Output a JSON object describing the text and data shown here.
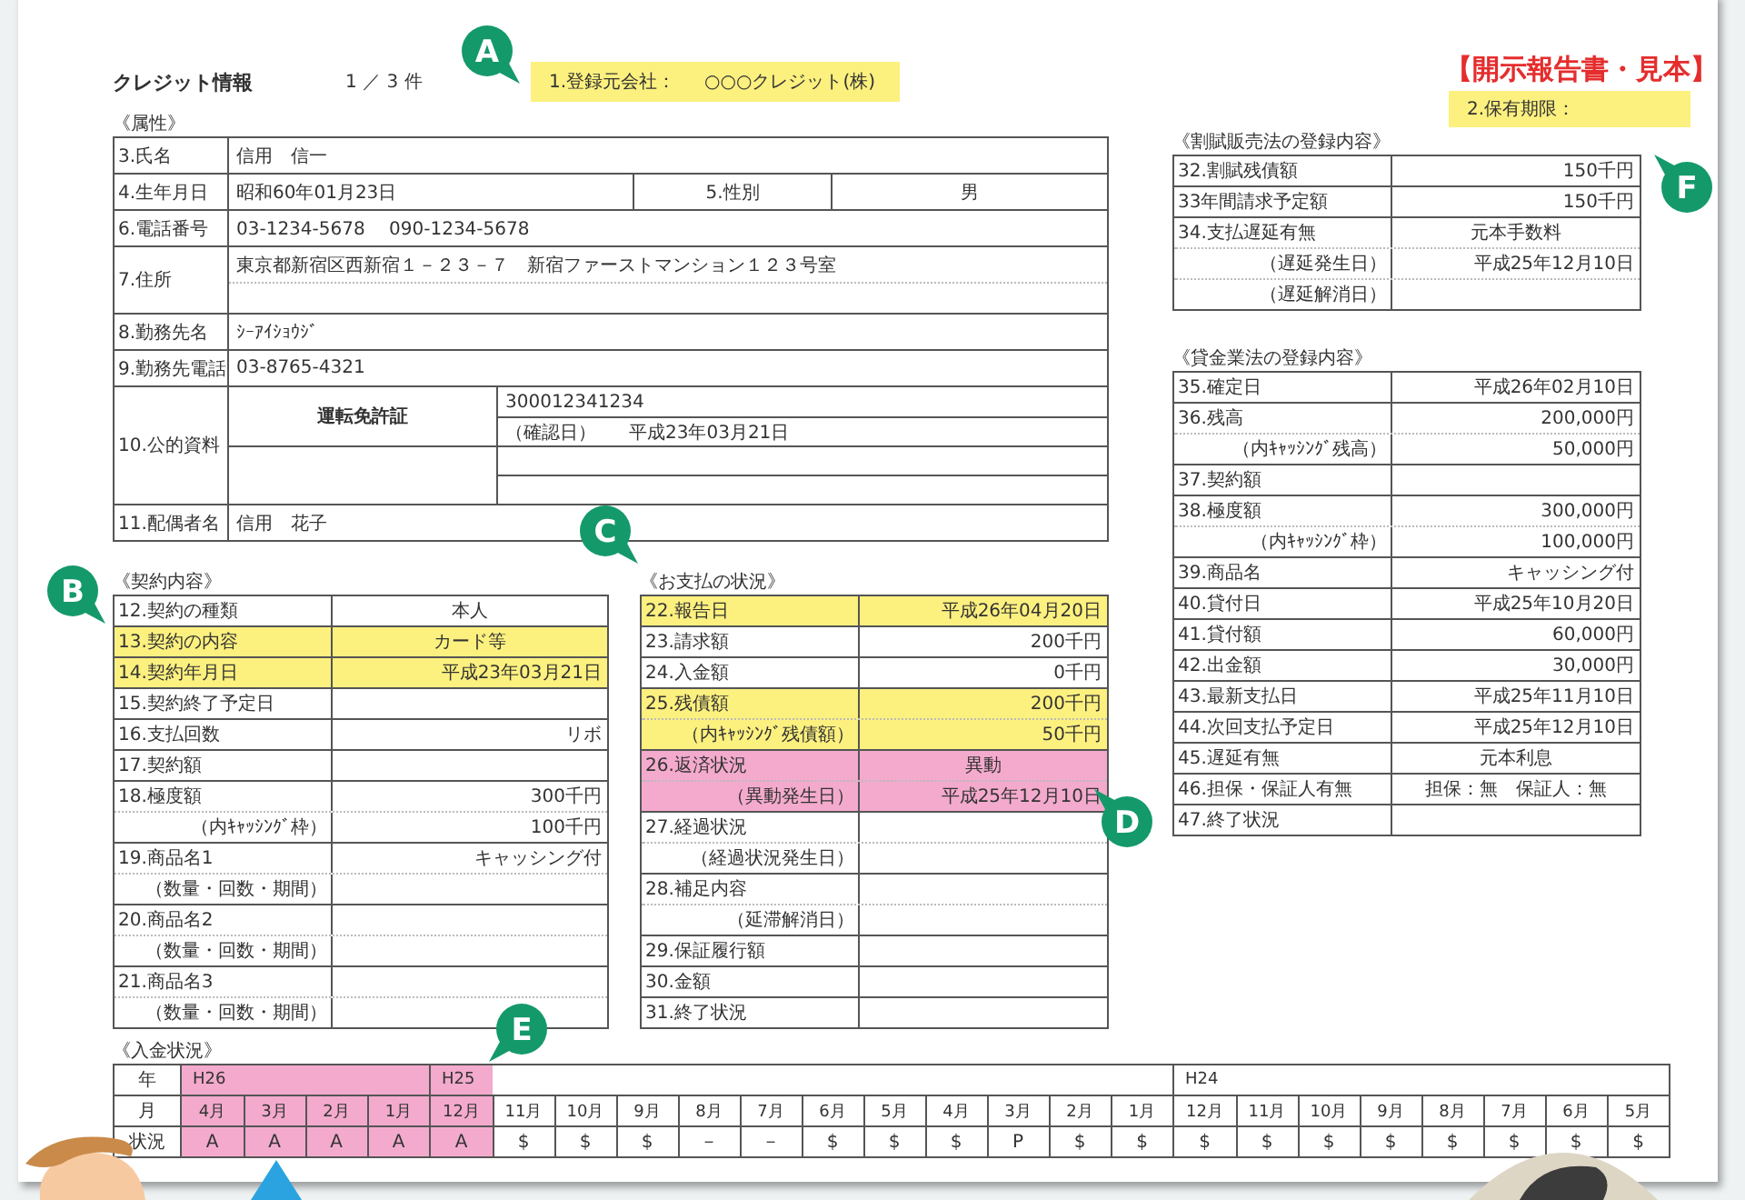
{
  "header": {
    "title": "クレジット情報",
    "count": "1 ／ 3 件",
    "company_label": "1.登録元会社：",
    "company_value": "○○○クレジット(株)",
    "color": "#fcf07f"
  },
  "stamp": "【開示報告書・見本】",
  "retention": {
    "label": "2.保有期限：",
    "color": "#fcf07f"
  },
  "callouts": [
    {
      "letter": "A"
    },
    {
      "letter": "B"
    },
    {
      "letter": "C"
    },
    {
      "letter": "D"
    },
    {
      "letter": "E"
    },
    {
      "letter": "F"
    }
  ],
  "attributes": {
    "heading": "《属性》",
    "name_label": "3.氏名",
    "name": "信用　信一",
    "birth_label": "4.生年月日",
    "birth": "昭和60年01月23日",
    "sex_label": "5.性別",
    "sex": "男",
    "phone_label": "6.電話番号",
    "phone": "03-1234-5678　 090-1234-5678",
    "address_label": "7.住所",
    "address": "東京都新宿区西新宿１－２３－７　新宿ファーストマンション１２３号室",
    "employer_label": "8.勤務先名",
    "employer": "ｼｰｱｲｼｮｳｼﾞ",
    "employer_phone_label": "9.勤務先電話",
    "employer_phone": "03-8765-4321",
    "docs_label": "10.公的資料",
    "doc_type": "運転免許証",
    "doc_number": "300012341234",
    "doc_confirm_label": "（確認日）",
    "doc_confirm": "平成23年03月21日",
    "spouse_label": "11.配偶者名",
    "spouse": "信用　花子"
  },
  "contract": {
    "heading": "《契約内容》",
    "rows": [
      {
        "label": "12.契約の種類",
        "value": "本人",
        "kind": "text"
      },
      {
        "label": "13.契約の内容",
        "value": "カード等",
        "kind": "text",
        "color": "#fcf07f"
      },
      {
        "label": "14.契約年月日",
        "value": "平成23年03月21日",
        "kind": "amount",
        "color": "#fcf07f"
      },
      {
        "label": "15.契約終了予定日"
      },
      {
        "label": "16.支払回数",
        "value": "リボ",
        "kind": "amount"
      },
      {
        "label": "17.契約額"
      },
      {
        "label": "18.極度額",
        "value": "300千円",
        "kind": "amount",
        "subs": [
          {
            "label": "（内ｷｬｯｼﾝｸﾞ枠）",
            "value": "100千円",
            "kind": "amount"
          }
        ]
      },
      {
        "label": "19.商品名1",
        "value": "キャッシング付",
        "kind": "amount",
        "subs": [
          {
            "label": "（数量・回数・期間）"
          }
        ]
      },
      {
        "label": "20.商品名2",
        "subs": [
          {
            "label": "（数量・回数・期間）"
          }
        ]
      },
      {
        "label": "21.商品名3",
        "subs": [
          {
            "label": "（数量・回数・期間）"
          }
        ]
      }
    ]
  },
  "payments": {
    "heading": "《お支払の状況》",
    "rows": [
      {
        "label": "22.報告日",
        "value": "平成26年04月20日",
        "kind": "amount",
        "color": "#fcf07f"
      },
      {
        "label": "23.請求額",
        "value": "200千円",
        "kind": "amount"
      },
      {
        "label": "24.入金額",
        "value": "0千円",
        "kind": "amount"
      },
      {
        "label": "25.残債額",
        "value": "200千円",
        "kind": "amount",
        "color": "#fcf07f",
        "subs": [
          {
            "label": "（内ｷｬｯｼﾝｸﾞ残債額）",
            "value": "50千円",
            "kind": "amount"
          }
        ]
      },
      {
        "label": "26.返済状況",
        "value": "異動",
        "kind": "text",
        "color": "#f3aacd",
        "subs": [
          {
            "label": "（異動発生日）",
            "value": "平成25年12月10日",
            "kind": "amount"
          }
        ]
      },
      {
        "label": "27.経過状況",
        "subs": [
          {
            "label": "（経過状況発生日）"
          }
        ]
      },
      {
        "label": "28.補足内容",
        "subs": [
          {
            "label": "（延滞解消日）"
          }
        ]
      },
      {
        "label": "29.保証履行額"
      },
      {
        "label": "30.金額"
      },
      {
        "label": "31.終了状況"
      }
    ]
  },
  "installment": {
    "heading": "《割賦販売法の登録内容》",
    "rows": [
      {
        "label": "32.割賦残債額",
        "value": "150千円",
        "kind": "amount"
      },
      {
        "label": "33年間請求予定額",
        "value": "150千円",
        "kind": "amount"
      },
      {
        "label": "34.支払遅延有無",
        "value": "元本手数料",
        "kind": "text",
        "subs": [
          {
            "label": "（遅延発生日）",
            "value": "平成25年12月10日",
            "kind": "amount"
          },
          {
            "label": "（遅延解消日）"
          }
        ]
      }
    ]
  },
  "lending": {
    "heading": "《貸金業法の登録内容》",
    "rows": [
      {
        "label": "35.確定日",
        "value": "平成26年02月10日",
        "kind": "amount"
      },
      {
        "label": "36.残高",
        "value": "200,000円",
        "kind": "amount",
        "subs": [
          {
            "label": "（内ｷｬｯｼﾝｸﾞ残高）",
            "value": "50,000円",
            "kind": "amount"
          }
        ]
      },
      {
        "label": "37.契約額"
      },
      {
        "label": "38.極度額",
        "value": "300,000円",
        "kind": "amount",
        "subs": [
          {
            "label": "（内ｷｬｯｼﾝｸﾞ枠）",
            "value": "100,000円",
            "kind": "amount"
          }
        ]
      },
      {
        "label": "39.商品名",
        "value": "キャッシング付",
        "kind": "amount"
      },
      {
        "label": "40.貸付日",
        "value": "平成25年10月20日",
        "kind": "amount"
      },
      {
        "label": "41.貸付額",
        "value": "60,000円",
        "kind": "amount"
      },
      {
        "label": "42.出金額",
        "value": "30,000円",
        "kind": "amount"
      },
      {
        "label": "43.最新支払日",
        "value": "平成25年11月10日",
        "kind": "amount"
      },
      {
        "label": "44.次回支払予定日",
        "value": "平成25年12月10日",
        "kind": "amount"
      },
      {
        "label": "45.遅延有無",
        "value": "元本利息",
        "kind": "text"
      },
      {
        "label": "46.担保・保証人有無",
        "value": "担保：無　保証人：無",
        "kind": "text"
      },
      {
        "label": "47.終了状況"
      }
    ]
  },
  "history": {
    "heading": "《入金状況》",
    "year_label": "年",
    "month_label": "月",
    "status_label": "状況",
    "years": [
      {
        "label": "H26",
        "months": [
          {
            "label": "4月",
            "status": "A",
            "color": "#f3aacd"
          },
          {
            "label": "3月",
            "status": "A",
            "color": "#f3aacd"
          },
          {
            "label": "2月",
            "status": "A",
            "color": "#f3aacd"
          },
          {
            "label": "1月",
            "status": "A",
            "color": "#f3aacd"
          }
        ]
      },
      {
        "label": "H25",
        "months": [
          {
            "label": "12月",
            "status": "A",
            "color": "#f3aacd"
          },
          {
            "label": "11月",
            "status": "$"
          },
          {
            "label": "10月",
            "status": "$"
          },
          {
            "label": "9月",
            "status": "$"
          },
          {
            "label": "8月",
            "status": "－"
          },
          {
            "label": "7月",
            "status": "－"
          },
          {
            "label": "6月",
            "status": "$"
          },
          {
            "label": "5月",
            "status": "$"
          },
          {
            "label": "4月",
            "status": "$"
          },
          {
            "label": "3月",
            "status": "P"
          },
          {
            "label": "2月",
            "status": "$"
          },
          {
            "label": "1月",
            "status": "$"
          }
        ]
      },
      {
        "label": "H24",
        "months": [
          {
            "label": "12月",
            "status": "$"
          },
          {
            "label": "11月",
            "status": "$"
          },
          {
            "label": "10月",
            "status": "$"
          },
          {
            "label": "9月",
            "status": "$"
          },
          {
            "label": "8月",
            "status": "$"
          },
          {
            "label": "7月",
            "status": "$"
          },
          {
            "label": "6月",
            "status": "$"
          },
          {
            "label": "5月",
            "status": "$"
          }
        ]
      }
    ]
  }
}
